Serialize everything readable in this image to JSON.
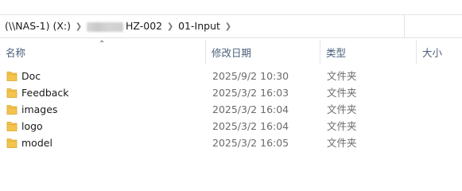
{
  "breadcrumb": {
    "root": "(\\\\NAS-1) (X:)",
    "folder_visible_suffix": "HZ-002",
    "current": "01-Input"
  },
  "columns": {
    "name": "名称",
    "date": "修改日期",
    "type": "类型",
    "size": "大小"
  },
  "sort": {
    "column": "name",
    "direction": "ascending"
  },
  "files": [
    {
      "name": "Doc",
      "date": "2025/9/2 10:30",
      "type": "文件夹",
      "icon": "folder-icon"
    },
    {
      "name": "Feedback",
      "date": "2025/3/2 16:03",
      "type": "文件夹",
      "icon": "folder-icon"
    },
    {
      "name": "images",
      "date": "2025/3/2 16:04",
      "type": "文件夹",
      "icon": "folder-icon"
    },
    {
      "name": "logo",
      "date": "2025/3/2 16:04",
      "type": "文件夹",
      "icon": "folder-icon"
    },
    {
      "name": "model",
      "date": "2025/3/2 16:05",
      "type": "文件夹",
      "icon": "folder-icon"
    }
  ],
  "colors": {
    "header_text": "#4c607a",
    "folder": "#f3c34d",
    "muted_text": "#6b6b6b"
  }
}
